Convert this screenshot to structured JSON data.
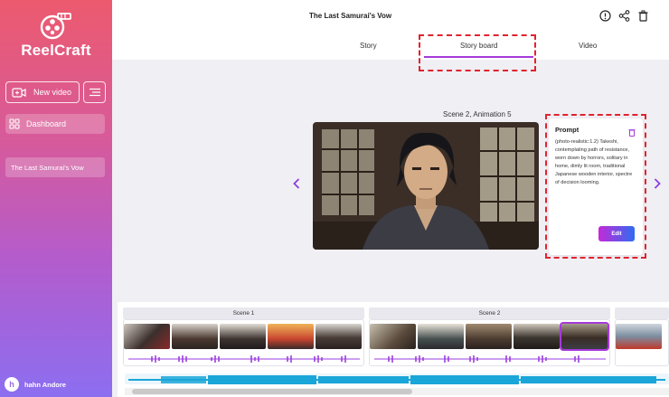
{
  "app": {
    "name": "ReelCraft"
  },
  "sidebar": {
    "new_video_label": "New video",
    "dashboard_label": "Dashboard",
    "projects": [
      "The Last Samurai's Vow"
    ],
    "user_name": "hahn Andore",
    "user_initial": "h"
  },
  "header": {
    "title": "The Last Samurai's Vow"
  },
  "tabs": {
    "story": "Story",
    "storyboard": "Story board",
    "video": "Video",
    "active": "Story board"
  },
  "main": {
    "scene_title": "Scene 2, Animation 5",
    "prompt": {
      "label": "Prompt",
      "text": "(photo-realistic:1.2) Takeshi, contemplating path of resistance, worn down by horrors, solitary in home, dimly lit room, traditional Japanese wooden interior, spectre of decision looming.",
      "edit_label": "Edit"
    }
  },
  "timeline": {
    "scenes": [
      {
        "label": "Scene 1",
        "thumb_count": 5
      },
      {
        "label": "Scene 2",
        "thumb_count": 5,
        "selected_index": 4
      }
    ]
  },
  "colors": {
    "accent": "#a53ad9",
    "highlight": "#e0232f",
    "audio": "#1aa6d8",
    "wave": "#9b3fe0"
  }
}
